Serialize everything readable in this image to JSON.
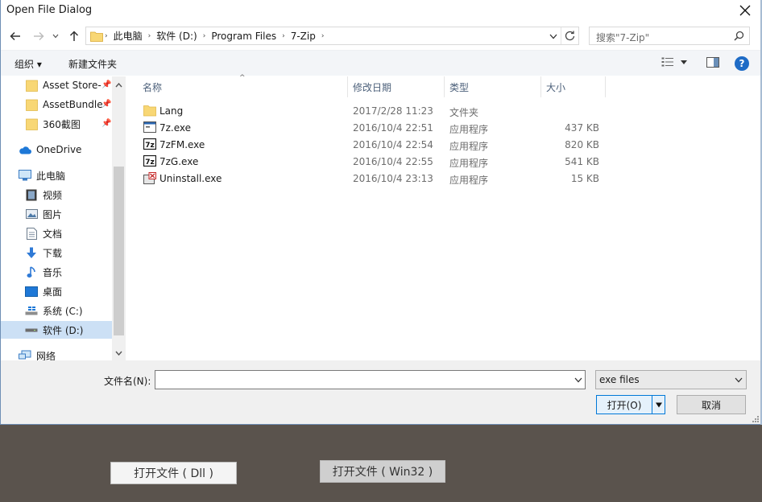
{
  "dialog": {
    "title": "Open File Dialog"
  },
  "address": {
    "crumbs": [
      "此电脑",
      "软件 (D:)",
      "Program Files",
      "7-Zip"
    ]
  },
  "search": {
    "placeholder": "搜索\"7-Zip\""
  },
  "toolbar": {
    "organize": "组织 ▾",
    "new_folder": "新建文件夹"
  },
  "nav": {
    "quick": [
      {
        "label": "Asset Store-",
        "icon": "folder-icon"
      },
      {
        "label": "AssetBundle",
        "icon": "folder-icon"
      },
      {
        "label": "360截图",
        "icon": "folder-icon"
      }
    ],
    "onedrive": "OneDrive",
    "this_pc": "此电脑",
    "pc_items": [
      {
        "label": "视频",
        "icon": "video-icon"
      },
      {
        "label": "图片",
        "icon": "pictures-icon"
      },
      {
        "label": "文档",
        "icon": "documents-icon"
      },
      {
        "label": "下载",
        "icon": "download-icon"
      },
      {
        "label": "音乐",
        "icon": "music-icon"
      },
      {
        "label": "桌面",
        "icon": "desktop-icon"
      },
      {
        "label": "系统 (C:)",
        "icon": "drive-c-icon"
      },
      {
        "label": "软件 (D:)",
        "icon": "drive-d-icon"
      }
    ],
    "network": "网络"
  },
  "columns": {
    "name": "名称",
    "date": "修改日期",
    "type": "类型",
    "size": "大小"
  },
  "files": [
    {
      "name": "Lang",
      "date": "2017/2/28 11:23",
      "type": "文件夹",
      "size": "",
      "icon": "folder-icon"
    },
    {
      "name": "7z.exe",
      "date": "2016/10/4 22:51",
      "type": "应用程序",
      "size": "437 KB",
      "icon": "console-app-icon"
    },
    {
      "name": "7zFM.exe",
      "date": "2016/10/4 22:54",
      "type": "应用程序",
      "size": "820 KB",
      "icon": "7zip-icon"
    },
    {
      "name": "7zG.exe",
      "date": "2016/10/4 22:55",
      "type": "应用程序",
      "size": "541 KB",
      "icon": "7zip-icon"
    },
    {
      "name": "Uninstall.exe",
      "date": "2016/10/4 23:13",
      "type": "应用程序",
      "size": "15 KB",
      "icon": "uninstall-icon"
    }
  ],
  "footer": {
    "filename_label": "文件名(N):",
    "filename_value": "",
    "filter_value": "exe files",
    "open_label": "打开(O)",
    "cancel_label": "取消"
  },
  "background_buttons": {
    "left_label": "打开文件 ( Dll )",
    "right_label": "打开文件 ( Win32 )"
  }
}
